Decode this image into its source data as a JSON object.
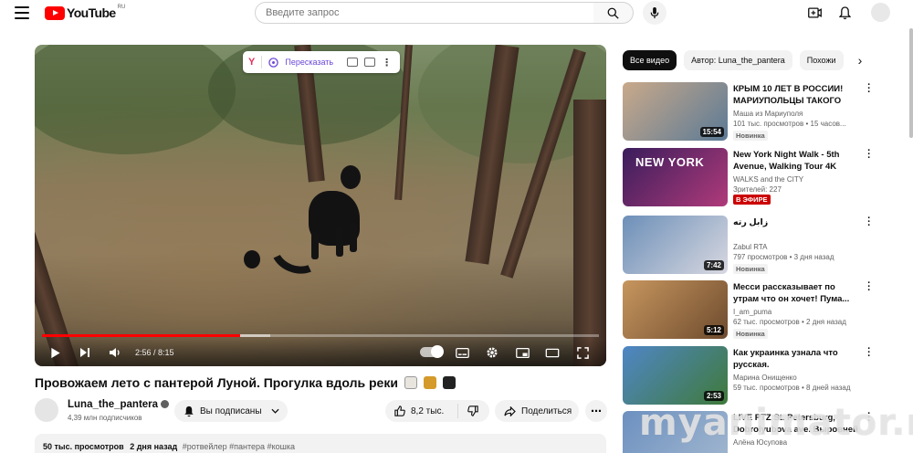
{
  "header": {
    "logo_text": "YouTube",
    "logo_region": "RU",
    "search_placeholder": "Введите запрос"
  },
  "player": {
    "extension": {
      "brand": "Y",
      "label": "Пересказать"
    },
    "current_time": "2:56",
    "duration": "8:15",
    "time_display": "2:56 / 8:15",
    "progress_fraction": 0.356,
    "buffer_fraction": 0.41
  },
  "video": {
    "title": "Провожаем лето с пантерой Луной. Прогулка вдоль реки",
    "channel_name": "Luna_the_pantera",
    "subscribers": "4,39 млн подписчиков",
    "subscribe_label": "Вы подписаны",
    "likes": "8,2 тыс.",
    "share_label": "Поделиться",
    "views": "50 тыс. просмотров",
    "published": "2 дня назад",
    "tags": "#ротвейлер #пантера #кошка"
  },
  "chips": [
    {
      "label": "Все видео",
      "active": true
    },
    {
      "label": "Автор: Luna_the_pantera",
      "active": false
    },
    {
      "label": "Похожи",
      "active": false
    }
  ],
  "recommendations": [
    {
      "title": "КРЫМ 10 ЛЕТ В РОССИИ! МАРИУПОЛЬЦЫ ТАКОГО ЕЩ...",
      "channel": "Маша из Мариуполя",
      "meta": "101 тыс. просмотров • 15 часов...",
      "badge": "Новинка",
      "duration": "15:54",
      "thumb_colors": [
        "#c9a98a",
        "#5b7a96"
      ]
    },
    {
      "title": "New York Night Walk - 5th Avenue, Walking Tour 4K",
      "channel": "WALKS and the CITY",
      "meta": "Зрителей: 227",
      "badge": "В ЭФИРЕ",
      "duration": "",
      "thumb_text": "NEW YORK",
      "thumb_colors": [
        "#3a1d5c",
        "#b03a7a"
      ]
    },
    {
      "title": "زابل رته",
      "channel": "Zabul RTA",
      "meta": "797 просмотров • 3 дня назад",
      "badge": "Новинка",
      "duration": "7:42",
      "thumb_colors": [
        "#6c8fb8",
        "#d8d8e0"
      ]
    },
    {
      "title": "Месси рассказывает по утрам что он хочет! Пума...",
      "channel": "I_am_puma",
      "meta": "62 тыс. просмотров • 2 дня назад",
      "badge": "Новинка",
      "duration": "5:12",
      "thumb_colors": [
        "#c7965e",
        "#6e4b2e"
      ]
    },
    {
      "title": "Как украинка узнала что русская.",
      "channel": "Марина Онищенко",
      "meta": "59 тыс. просмотров • 8 дней назад",
      "badge": "",
      "duration": "2:53",
      "thumb_colors": [
        "#4f86c6",
        "#3f7a3a"
      ]
    },
    {
      "title": "LIVE PTZ St. Petersburg, Dobrolyubova ave. Выровней",
      "channel": "Алёна Юсупова",
      "meta": "",
      "badge": "",
      "duration": "",
      "thumb_colors": [
        "#6c90c0",
        "#a3b8cf"
      ]
    }
  ],
  "watermark": "myanimator.ru",
  "colors": {
    "brand_red": "#ff0000",
    "chip_active": "#0f0f0f",
    "ext_accent": "#6b47d6"
  }
}
